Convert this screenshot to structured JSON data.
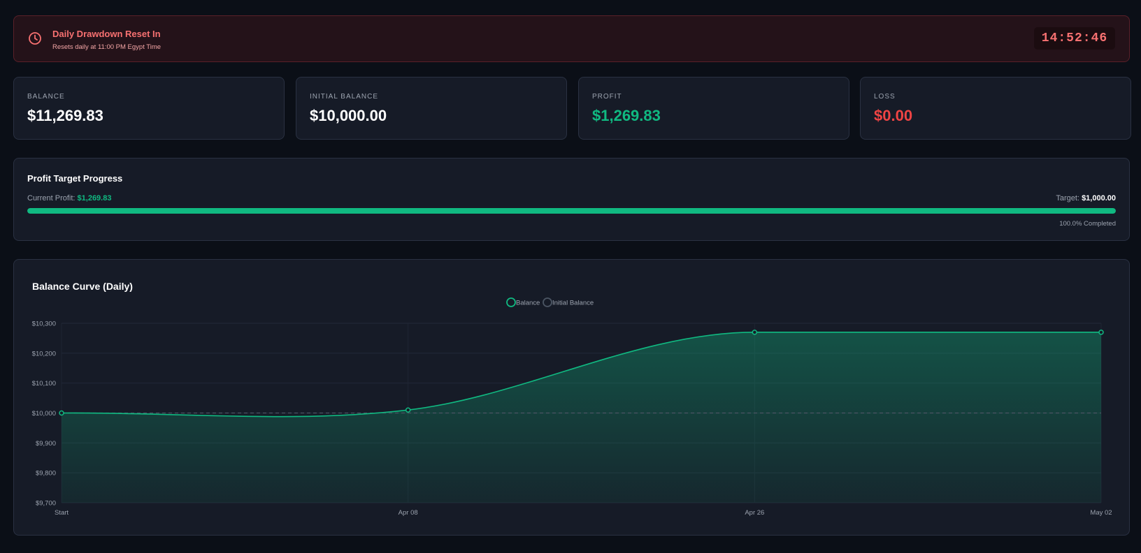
{
  "banner": {
    "title": "Daily Drawdown Reset In",
    "subtitle": "Resets daily at 11:00 PM Egypt Time",
    "timer": "14:52:46",
    "icon": "clock-icon"
  },
  "stats": [
    {
      "label": "BALANCE",
      "value": "$11,269.83",
      "color": "#ffffff"
    },
    {
      "label": "INITIAL BALANCE",
      "value": "$10,000.00",
      "color": "#ffffff"
    },
    {
      "label": "PROFIT",
      "value": "$1,269.83",
      "color": "#10b981"
    },
    {
      "label": "LOSS",
      "value": "$0.00",
      "color": "#ef4444"
    }
  ],
  "progress": {
    "title": "Profit Target Progress",
    "current_label": "Current Profit:",
    "current_value": "$1,269.83",
    "target_label": "Target:",
    "target_value": "$1,000.00",
    "completed_text": "100.0% Completed",
    "percent": 100
  },
  "chart": {
    "title": "Balance Curve (Daily)"
  },
  "chart_data": {
    "type": "line",
    "x": [
      "Start",
      "Apr 08",
      "Apr 26",
      "May 02"
    ],
    "series": [
      {
        "name": "Balance",
        "values": [
          10000,
          10010,
          10270,
          10270
        ],
        "color": "#10b981",
        "fill": true
      },
      {
        "name": "Initial Balance",
        "values": [
          10000,
          10000,
          10000,
          10000
        ],
        "color": "#6b7280",
        "dashed": true
      }
    ],
    "ylim": [
      9700,
      10300
    ],
    "yticks": [
      "$10,300",
      "$10,200",
      "$10,100",
      "$10,000",
      "$9,900",
      "$9,800",
      "$9,700"
    ],
    "ytick_values": [
      10300,
      10200,
      10100,
      10000,
      9900,
      9800,
      9700
    ],
    "legend_position": "top-center",
    "grid": true
  },
  "colors": {
    "accent": "#10b981",
    "danger": "#ef4444",
    "background": "#0b0f17",
    "card": "#161b27"
  }
}
